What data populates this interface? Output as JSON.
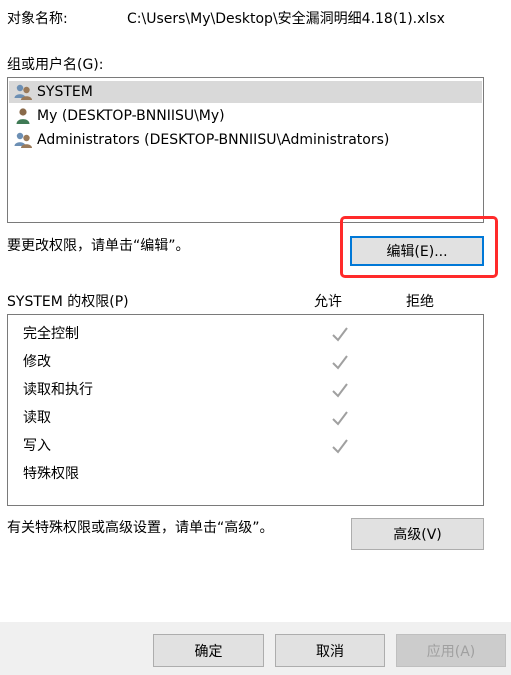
{
  "header": {
    "object_label": "对象名称:",
    "object_path": "C:\\Users\\My\\Desktop\\安全漏洞明细4.18(1).xlsx"
  },
  "groups": {
    "label": "组或用户名(G):",
    "items": [
      {
        "label": "SYSTEM",
        "icon": "users-group-icon",
        "selected": true
      },
      {
        "label": "My (DESKTOP-BNNIISU\\My)",
        "icon": "user-icon",
        "selected": false
      },
      {
        "label": "Administrators (DESKTOP-BNNIISU\\Administrators)",
        "icon": "users-group-icon",
        "selected": false
      }
    ]
  },
  "edit_hint": "要更改权限，请单击“编辑”。",
  "edit_button": "编辑(E)...",
  "permissions": {
    "title": "SYSTEM 的权限(P)",
    "allow_header": "允许",
    "deny_header": "拒绝",
    "rows": [
      {
        "label": "完全控制",
        "allow": true,
        "deny": false
      },
      {
        "label": "修改",
        "allow": true,
        "deny": false
      },
      {
        "label": "读取和执行",
        "allow": true,
        "deny": false
      },
      {
        "label": "读取",
        "allow": true,
        "deny": false
      },
      {
        "label": "写入",
        "allow": true,
        "deny": false
      },
      {
        "label": "特殊权限",
        "allow": false,
        "deny": false
      }
    ]
  },
  "advanced_hint": "有关特殊权限或高级设置，请单击“高级”。",
  "advanced_button": "高级(V)",
  "footer": {
    "ok": "确定",
    "cancel": "取消",
    "apply": "应用(A)"
  },
  "colors": {
    "highlight_box": "#ff2a2a",
    "focus_border": "#0078d7",
    "check_gray": "#a0a0a0"
  }
}
